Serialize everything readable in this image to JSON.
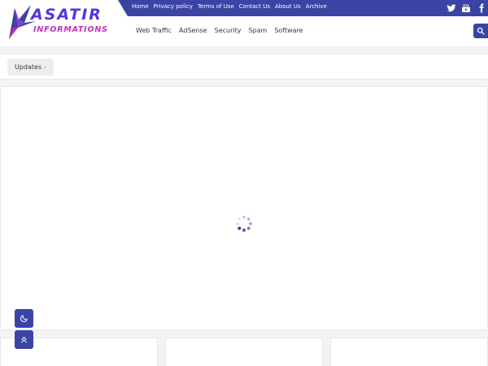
{
  "logo": {
    "line1": "ASATIR",
    "line2": "INFORMATIONS"
  },
  "top_links": [
    "Home",
    "Privacy policy",
    "Terms of Use",
    "Contact Us",
    "About Us",
    "Archive"
  ],
  "social": [
    "twitter-icon",
    "youtube-icon",
    "facebook-icon"
  ],
  "nav": [
    "Web Traffic",
    "AdSense",
    "Security",
    "Spam",
    "Software"
  ],
  "breadcrumb": {
    "label": "Updates",
    "separator": "›"
  },
  "colors": {
    "brand": "#3b44a5",
    "logo_primary": "#5533e0",
    "logo_secondary": "#c22fb8",
    "background": "#f3f3f3",
    "panel": "#ffffff"
  },
  "icons": {
    "search": "search-icon",
    "dark_mode": "moon-icon",
    "scroll_top": "double-chevron-up-icon",
    "loader": "loading-spinner-icon"
  }
}
